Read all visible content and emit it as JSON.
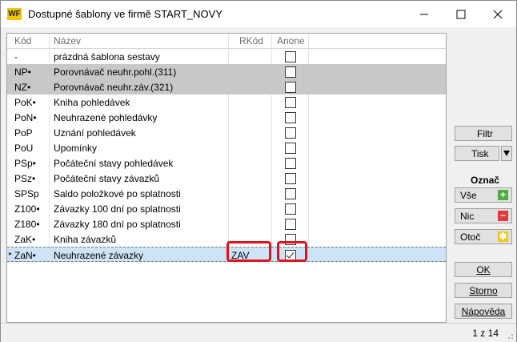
{
  "window": {
    "title": "Dostupné šablony ve firmě START_NOVY",
    "logo": "WF"
  },
  "columns": {
    "kod": "Kód",
    "nazev": "Název",
    "rkod": "RKód",
    "anone": "Anone"
  },
  "rows": [
    {
      "kod": "-",
      "nazev": "prázdná šablona sestavy",
      "rkod": "",
      "checked": false,
      "style": "normal"
    },
    {
      "kod": "NP•",
      "nazev": "Porovnávač neuhr.pohl.(311)",
      "rkod": "",
      "checked": false,
      "style": "gray"
    },
    {
      "kod": "NZ•",
      "nazev": "Porovnávač neuhr.záv.(321)",
      "rkod": "",
      "checked": false,
      "style": "gray"
    },
    {
      "kod": "PoK•",
      "nazev": "Kniha pohledávek",
      "rkod": "",
      "checked": false,
      "style": "normal"
    },
    {
      "kod": "PoN•",
      "nazev": "Neuhrazené pohledávky",
      "rkod": "",
      "checked": false,
      "style": "normal"
    },
    {
      "kod": "PoP",
      "nazev": "Uznání pohledávek",
      "rkod": "",
      "checked": false,
      "style": "normal"
    },
    {
      "kod": "PoU",
      "nazev": "Upomínky",
      "rkod": "",
      "checked": false,
      "style": "normal"
    },
    {
      "kod": "PSp•",
      "nazev": "Počáteční stavy pohledávek",
      "rkod": "",
      "checked": false,
      "style": "normal"
    },
    {
      "kod": "PSz•",
      "nazev": "Počáteční stavy závazků",
      "rkod": "",
      "checked": false,
      "style": "normal"
    },
    {
      "kod": "SPSp",
      "nazev": "Saldo položkové po splatnosti",
      "rkod": "",
      "checked": false,
      "style": "normal"
    },
    {
      "kod": "Z100•",
      "nazev": "Závazky 100 dní po splatnosti",
      "rkod": "",
      "checked": false,
      "style": "normal"
    },
    {
      "kod": "Z180•",
      "nazev": "Závazky 180 dní po splatnosti",
      "rkod": "",
      "checked": false,
      "style": "normal"
    },
    {
      "kod": "ZaK•",
      "nazev": "Kniha závazků",
      "rkod": "",
      "checked": false,
      "style": "normal"
    },
    {
      "kod": "ZaN•",
      "nazev": "Neuhrazené závazky",
      "rkod": "ZAV",
      "checked": true,
      "style": "selected"
    }
  ],
  "side": {
    "filtr": "Filtr",
    "tisk": "Tisk",
    "oznac": "Označ",
    "vse": "Vše",
    "nic": "Nic",
    "otoc": "Otoč",
    "ok": "OK",
    "storno": "Storno",
    "napoveda": "Nápověda"
  },
  "colors": {
    "vse": "#4caf3c",
    "nic": "#e03a3a",
    "otoc": "#f5c518",
    "highlight": "#e0141e"
  },
  "status": {
    "pager": "1 z 14"
  }
}
